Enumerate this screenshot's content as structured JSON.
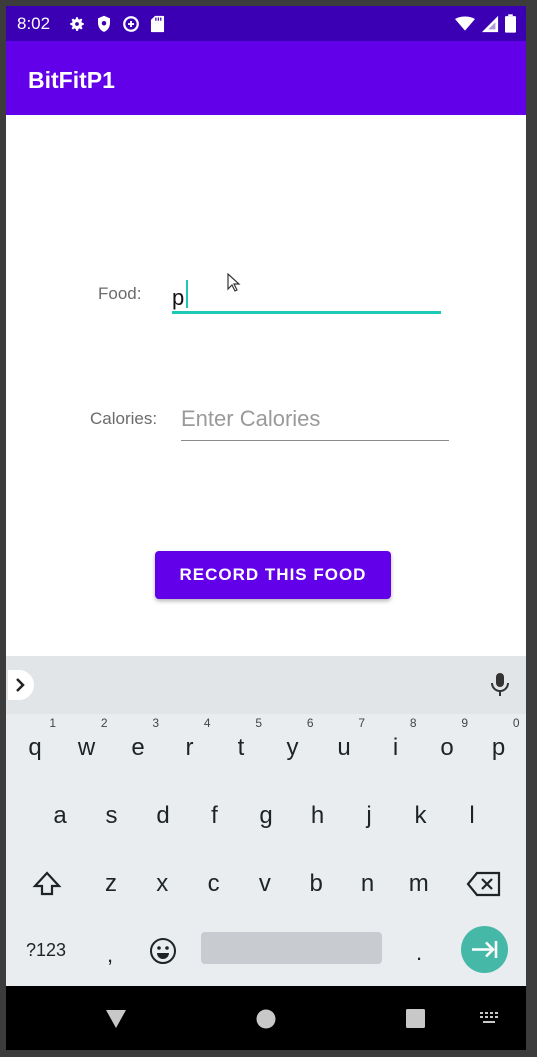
{
  "status_bar": {
    "time": "8:02",
    "left_icons": [
      "settings-icon",
      "shield-icon",
      "data-saver-icon",
      "sd-card-icon"
    ],
    "right_icons": [
      "wifi-icon",
      "signal-icon",
      "battery-icon"
    ]
  },
  "app_bar": {
    "title": "BitFitP1"
  },
  "form": {
    "food_label": "Food:",
    "food_value": "p",
    "calories_label": "Calories:",
    "calories_placeholder": "Enter Calories",
    "calories_value": "",
    "submit_label": "RECORD THIS FOOD"
  },
  "keyboard": {
    "row1": [
      {
        "key": "q",
        "hint": "1"
      },
      {
        "key": "w",
        "hint": "2"
      },
      {
        "key": "e",
        "hint": "3"
      },
      {
        "key": "r",
        "hint": "4"
      },
      {
        "key": "t",
        "hint": "5"
      },
      {
        "key": "y",
        "hint": "6"
      },
      {
        "key": "u",
        "hint": "7"
      },
      {
        "key": "i",
        "hint": "8"
      },
      {
        "key": "o",
        "hint": "9"
      },
      {
        "key": "p",
        "hint": "0"
      }
    ],
    "row2": [
      "a",
      "s",
      "d",
      "f",
      "g",
      "h",
      "j",
      "k",
      "l"
    ],
    "row3": [
      "z",
      "x",
      "c",
      "v",
      "b",
      "n",
      "m"
    ],
    "symbols_label": "?123",
    "comma": ",",
    "period": "."
  },
  "colors": {
    "status_bar": "#3b00b3",
    "primary": "#6200ea",
    "accent": "#1cc9b7",
    "keyboard_bg": "#e9edf0",
    "enter_key": "#45b8a8"
  }
}
